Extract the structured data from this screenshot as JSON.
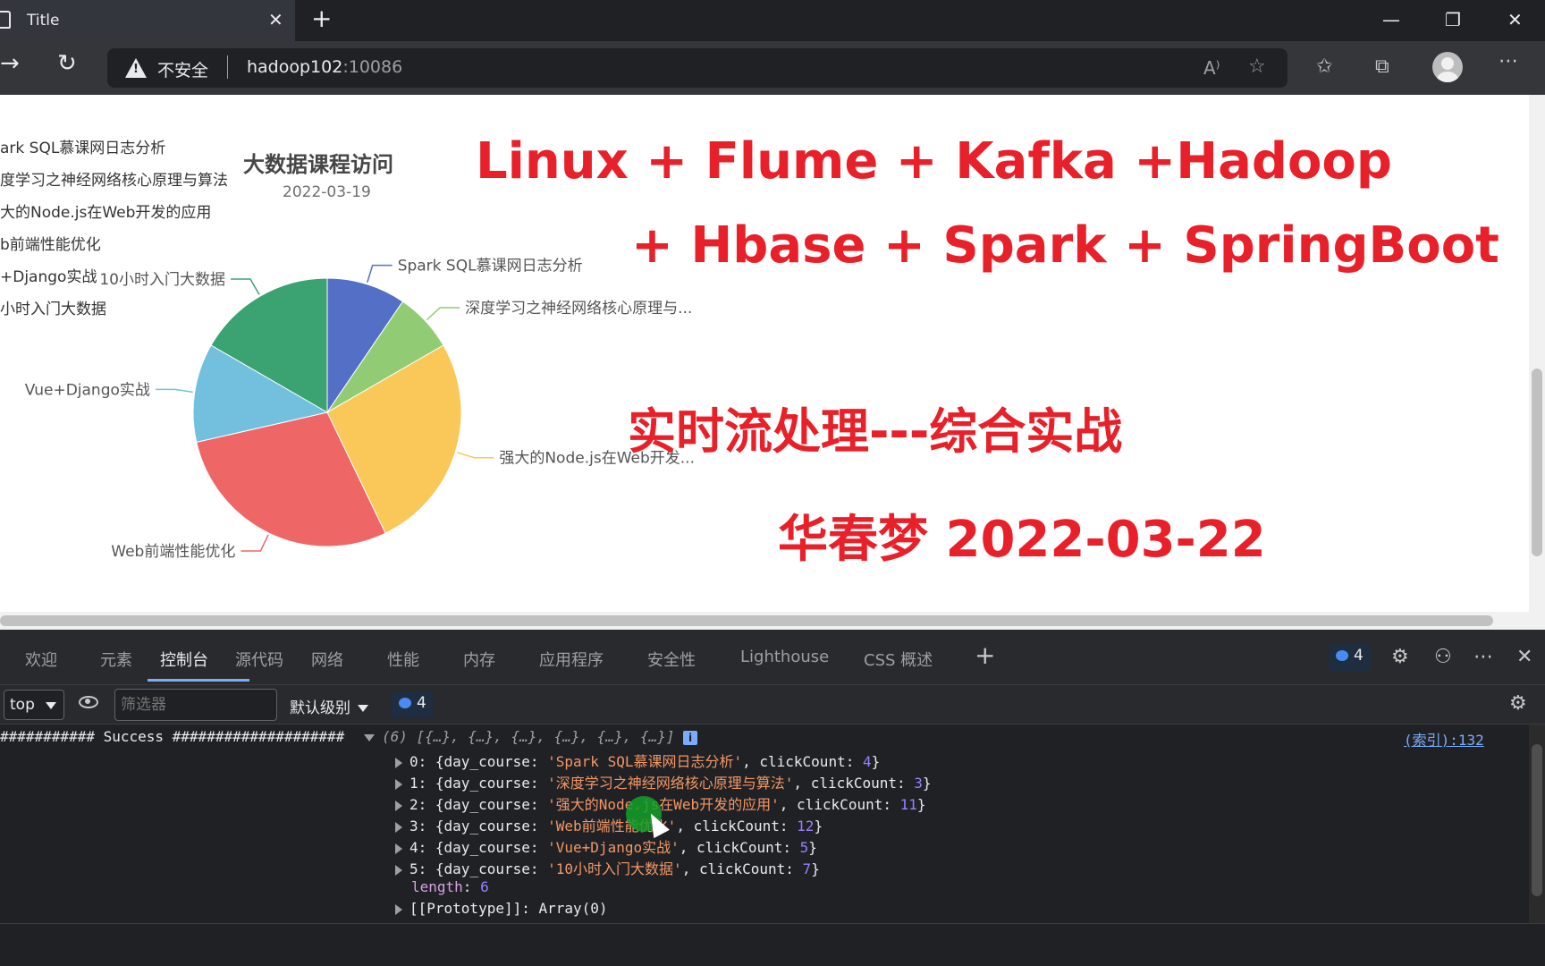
{
  "browser": {
    "tab_title": "Title",
    "tab_close": "✕",
    "new_tab": "+",
    "window_controls": {
      "minimize": "—",
      "restore": "❐",
      "close": "✕"
    },
    "address": {
      "security_label": "不安全",
      "host": "hadoop102",
      "port": ":10086"
    },
    "icons": [
      "forward-icon",
      "refresh-icon",
      "warning-icon",
      "read-aloud-icon",
      "favorite-add-icon",
      "favorites-icon",
      "collections-icon",
      "profile-icon",
      "more-icon"
    ]
  },
  "page": {
    "chart_title": "大数据课程访问",
    "chart_subtitle": "2022-03-19",
    "legend": [
      "ark SQL慕课网日志分析",
      "度学习之神经网络核心原理与算法",
      "大的Node.js在Web开发的应用",
      "b前端性能优化",
      "+Django实战",
      "小时入门大数据"
    ],
    "headline_line1": "Linux + Flume + Kafka +Hadoop",
    "headline_line2": "+ Hbase + Spark + SpringBoot",
    "headline_line3": "实时流处理---综合实战",
    "headline_line4": "华春梦 2022-03-22"
  },
  "chart_data": {
    "type": "pie",
    "title": "大数据课程访问",
    "subtitle": "2022-03-19",
    "slices": [
      {
        "name": "Spark SQL慕课网日志分析",
        "label": "Spark SQL慕课网日志分析",
        "value": 4,
        "color": "#5470c6"
      },
      {
        "name": "深度学习之神经网络核心原理与算法",
        "label": "深度学习之神经网络核心原理与...",
        "value": 3,
        "color": "#91cc75"
      },
      {
        "name": "强大的Node.js在Web开发的应用",
        "label": "强大的Node.js在Web开发...",
        "value": 11,
        "color": "#fac858"
      },
      {
        "name": "Web前端性能优化",
        "label": "Web前端性能优化",
        "value": 12,
        "color": "#ee6666"
      },
      {
        "name": "Vue+Django实战",
        "label": "Vue+Django实战",
        "value": 5,
        "color": "#73c0de"
      },
      {
        "name": "10小时入门大数据",
        "label": "10小时入门大数据",
        "value": 7,
        "color": "#3ba272"
      }
    ],
    "legend_placement": "top-left"
  },
  "devtools": {
    "tabs": [
      "欢迎",
      "元素",
      "控制台",
      "源代码",
      "网络",
      "性能",
      "内存",
      "应用程序",
      "安全性",
      "Lighthouse",
      "CSS 概述"
    ],
    "active_tab": "控制台",
    "issues_count": "4",
    "context": "top",
    "filter_placeholder": "筛选器",
    "level": "默认级别",
    "messages_count": "4",
    "console": {
      "log_prefix": "########### Success ####################",
      "array_summary": "(6) [{…}, {…}, {…}, {…}, {…}, {…}]",
      "info_mark": "i",
      "source_link": "(索引):132",
      "items": [
        {
          "index": "0",
          "day_course": "'Spark SQL慕课网日志分析'",
          "clickCount": "4"
        },
        {
          "index": "1",
          "day_course": "'深度学习之神经网络核心原理与算法'",
          "clickCount": "3"
        },
        {
          "index": "2",
          "day_course": "'强大的Node.js在Web开发的应用'",
          "clickCount": "11"
        },
        {
          "index": "3",
          "day_course": "'Web前端性能优化'",
          "clickCount": "12"
        },
        {
          "index": "4",
          "day_course": "'Vue+Django实战'",
          "clickCount": "5"
        },
        {
          "index": "5",
          "day_course": "'10小时入门大数据'",
          "clickCount": "7"
        }
      ],
      "length_label": "length",
      "length_value": "6",
      "prototype": "[[Prototype]]: Array(0)"
    }
  }
}
